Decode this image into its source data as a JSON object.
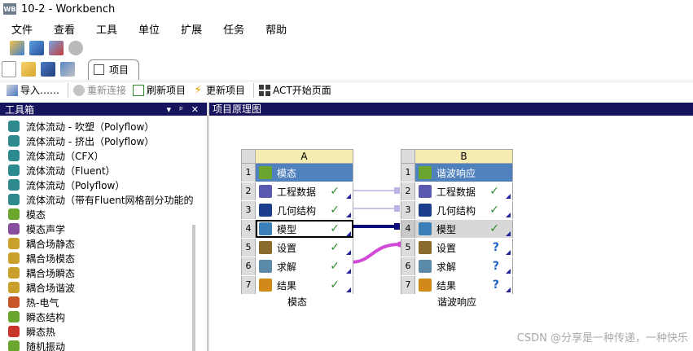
{
  "window": {
    "title": "10-2 - Workbench",
    "app_icon_text": "WB"
  },
  "menu": [
    "文件",
    "查看",
    "工具",
    "单位",
    "扩展",
    "任务",
    "帮助"
  ],
  "tab": {
    "label": "项目"
  },
  "actions": {
    "import": "导入……",
    "reconnect": "重新连接",
    "refresh": "刷新项目",
    "update": "更新项目",
    "act_start": "ACT开始页面"
  },
  "toolbox": {
    "title": "工具箱",
    "pin": "ᵖ",
    "pin_glyph": "ᴾ",
    "close": "✕",
    "items": [
      {
        "label": "流体流动 - 吹塑（Polyflow）",
        "color": "#2f8a8f"
      },
      {
        "label": "流体流动 - 挤出（Polyflow）",
        "color": "#2f8a8f"
      },
      {
        "label": "流体流动（CFX）",
        "color": "#2f8a8f"
      },
      {
        "label": "流体流动（Fluent）",
        "color": "#2f8a8f"
      },
      {
        "label": "流体流动（Polyflow）",
        "color": "#2f8a8f"
      },
      {
        "label": "流体流动（带有Fluent网格剖分功能的",
        "color": "#2f8a8f"
      },
      {
        "label": "模态",
        "color": "#6aa52e"
      },
      {
        "label": "模态声学",
        "color": "#8a4ea0"
      },
      {
        "label": "耦合场静态",
        "color": "#c9a02a"
      },
      {
        "label": "耦合场模态",
        "color": "#c9a02a"
      },
      {
        "label": "耦合场瞬态",
        "color": "#c9a02a"
      },
      {
        "label": "耦合场谐波",
        "color": "#c9a02a"
      },
      {
        "label": "热-电气",
        "color": "#c8552a"
      },
      {
        "label": "瞬态结构",
        "color": "#6aa52e"
      },
      {
        "label": "瞬态热",
        "color": "#c8362a"
      },
      {
        "label": "随机振动",
        "color": "#6aa52e"
      }
    ]
  },
  "schematic": {
    "title": "项目原理图",
    "systems": [
      {
        "column": "A",
        "name": "模态",
        "cells": [
          {
            "n": "1",
            "label": "模态",
            "status": "",
            "icon_color": "#6aa52e"
          },
          {
            "n": "2",
            "label": "工程数据",
            "status": "✓",
            "icon_color": "#5a5ab0"
          },
          {
            "n": "3",
            "label": "几何结构",
            "status": "✓",
            "icon_color": "#1c3e8c"
          },
          {
            "n": "4",
            "label": "模型",
            "status": "✓",
            "icon_color": "#3a7fb8"
          },
          {
            "n": "5",
            "label": "设置",
            "status": "✓",
            "icon_color": "#8a6a2a"
          },
          {
            "n": "6",
            "label": "求解",
            "status": "✓",
            "icon_color": "#5a8aa8"
          },
          {
            "n": "7",
            "label": "结果",
            "status": "✓",
            "icon_color": "#d08a1a"
          }
        ]
      },
      {
        "column": "B",
        "name": "谐波响应",
        "cells": [
          {
            "n": "1",
            "label": "谐波响应",
            "status": "",
            "icon_color": "#6aa52e"
          },
          {
            "n": "2",
            "label": "工程数据",
            "status": "✓",
            "icon_color": "#5a5ab0"
          },
          {
            "n": "3",
            "label": "几何结构",
            "status": "✓",
            "icon_color": "#1c3e8c"
          },
          {
            "n": "4",
            "label": "模型",
            "status": "✓",
            "icon_color": "#3a7fb8"
          },
          {
            "n": "5",
            "label": "设置",
            "status": "?",
            "icon_color": "#8a6a2a"
          },
          {
            "n": "6",
            "label": "求解",
            "status": "?",
            "icon_color": "#5a8aa8"
          },
          {
            "n": "7",
            "label": "结果",
            "status": "?",
            "icon_color": "#d08a1a"
          }
        ]
      }
    ]
  },
  "watermark": "CSDN @分享是一种传递，一种快乐"
}
